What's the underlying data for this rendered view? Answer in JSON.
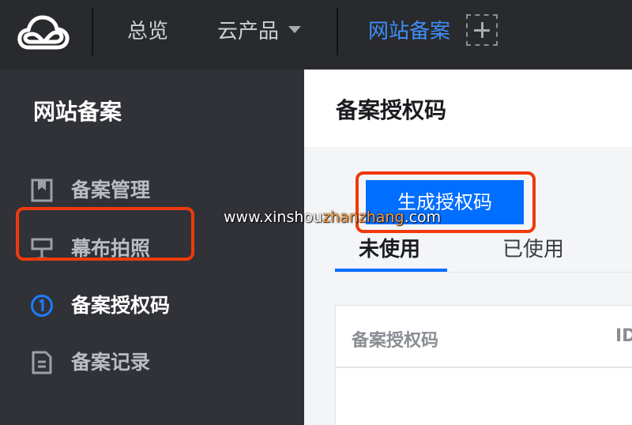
{
  "topbar": {
    "logo": "tencent-cloud-logo",
    "nav": {
      "overview": "总览",
      "products": "云产品",
      "icp": "网站备案"
    },
    "add_icon": "plus-icon"
  },
  "sidebar": {
    "title": "网站备案",
    "items": [
      {
        "label": "备案管理",
        "icon": "bookmark-icon"
      },
      {
        "label": "幕布拍照",
        "icon": "backdrop-icon"
      },
      {
        "label": "备案授权码",
        "icon": "step-one-icon"
      },
      {
        "label": "备案记录",
        "icon": "document-icon"
      }
    ]
  },
  "main": {
    "title": "备案授权码",
    "generate_button": "生成授权码",
    "tabs": [
      {
        "label": "未使用",
        "active": true
      },
      {
        "label": "已使用",
        "active": false
      }
    ],
    "table": {
      "columns": [
        "备案授权码",
        "ID"
      ]
    }
  },
  "watermark": {
    "prefix": "www.xinshou",
    "accent": "zhanzhang",
    "suffix": ".com"
  },
  "colors": {
    "topbar": "#292a2d",
    "sidebar": "#303237",
    "accent": "#006eff",
    "nav_active": "#3d8ef8",
    "highlight": "#ee3a0c"
  }
}
